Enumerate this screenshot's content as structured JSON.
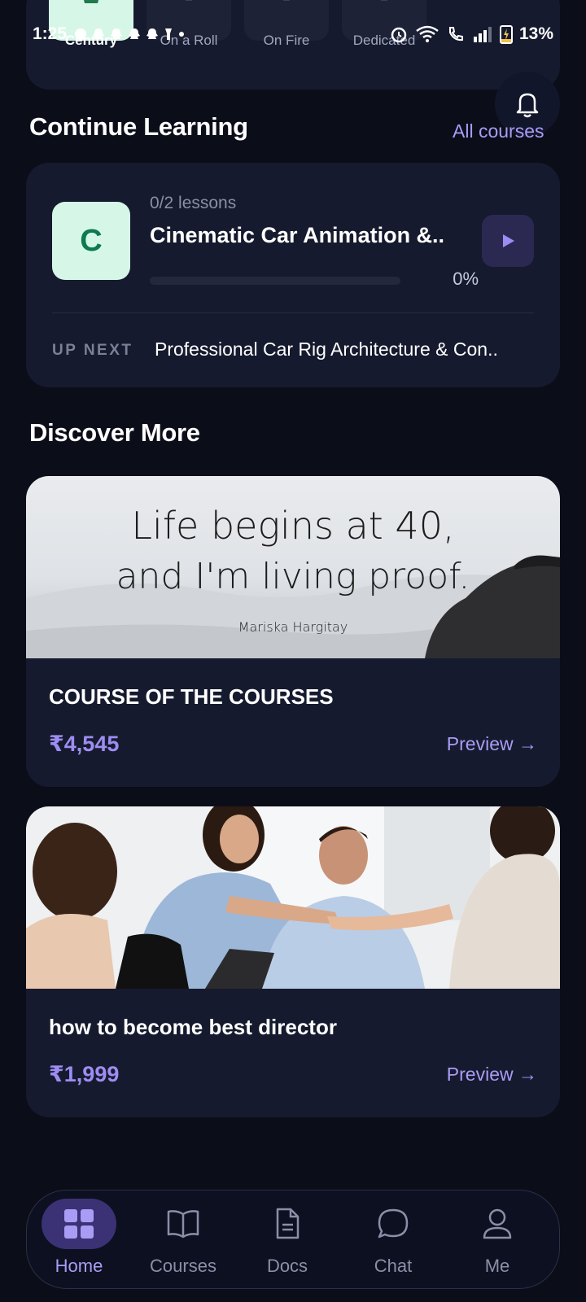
{
  "status_bar": {
    "time": "1:25",
    "battery": "13%"
  },
  "achievements": [
    {
      "label": "Century",
      "active": true
    },
    {
      "label": "On a Roll",
      "active": false
    },
    {
      "label": "On Fire",
      "active": false
    },
    {
      "label": "Dedicated",
      "active": false
    }
  ],
  "continue_learning": {
    "title": "Continue Learning",
    "all_link": "All courses",
    "course": {
      "thumb_letter": "C",
      "lessons": "0/2 lessons",
      "name": "Cinematic Car Animation &..",
      "progress_percent": 0,
      "progress_label": "0%"
    },
    "up_next_label": "UP NEXT",
    "up_next_title": "Professional Car Rig Architecture & Con.."
  },
  "discover": {
    "title": "Discover More",
    "cards": [
      {
        "image": "quote-image",
        "quote_line1": "Life begins at 40,",
        "quote_line2": "and I'm living proof.",
        "quote_author": "Mariska Hargitay",
        "title": "COURSE OF THE COURSES",
        "price": "₹4,545",
        "preview": "Preview →"
      },
      {
        "image": "business-handshake-photo",
        "title": "how to become best director",
        "price": "₹1,999",
        "preview": "Preview →"
      }
    ]
  },
  "nav": [
    {
      "label": "Home",
      "icon": "grid-icon",
      "active": true
    },
    {
      "label": "Courses",
      "icon": "book-icon",
      "active": false
    },
    {
      "label": "Docs",
      "icon": "document-icon",
      "active": false
    },
    {
      "label": "Chat",
      "icon": "chat-bubble-icon",
      "active": false
    },
    {
      "label": "Me",
      "icon": "user-icon",
      "active": false
    }
  ],
  "colors": {
    "background": "#0b0e19",
    "card": "#161a2e",
    "accent": "#a99cf5",
    "thumb_green": "#d6f7e7"
  }
}
